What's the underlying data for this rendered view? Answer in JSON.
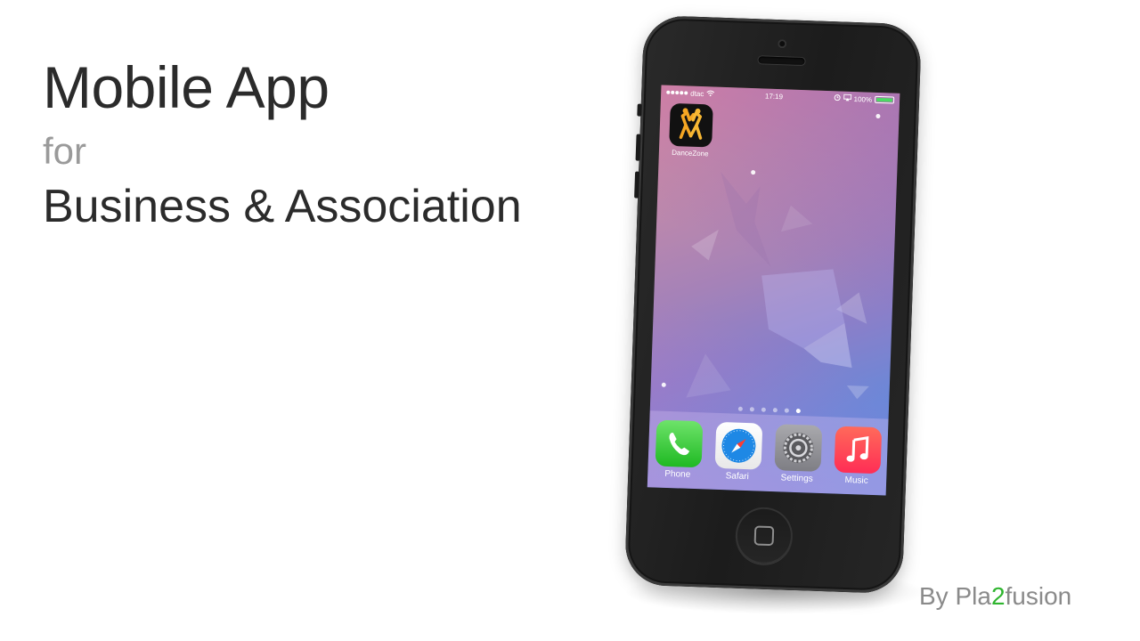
{
  "headline": {
    "title": "Mobile App",
    "connector": "for",
    "subtitle": "Business & Association"
  },
  "byline": {
    "prefix": "By Pla",
    "accent": "2",
    "suffix": "fusion"
  },
  "colors": {
    "accent_green": "#2fb52f",
    "title_dark": "#2b2b2b",
    "muted_grey": "#9a9a9a"
  },
  "phone": {
    "status_bar": {
      "carrier": "dtac",
      "time": "17:19",
      "battery": "100%",
      "battery_level": 1.0
    },
    "home_app": {
      "label": "DanceZone",
      "icon": "dancers-icon"
    },
    "page_indicator": {
      "count": 6,
      "active_index": 5
    },
    "dock": [
      {
        "label": "Phone",
        "icon": "phone-icon"
      },
      {
        "label": "Safari",
        "icon": "compass-icon"
      },
      {
        "label": "Settings",
        "icon": "gear-icon"
      },
      {
        "label": "Music",
        "icon": "music-note-icon"
      }
    ]
  }
}
